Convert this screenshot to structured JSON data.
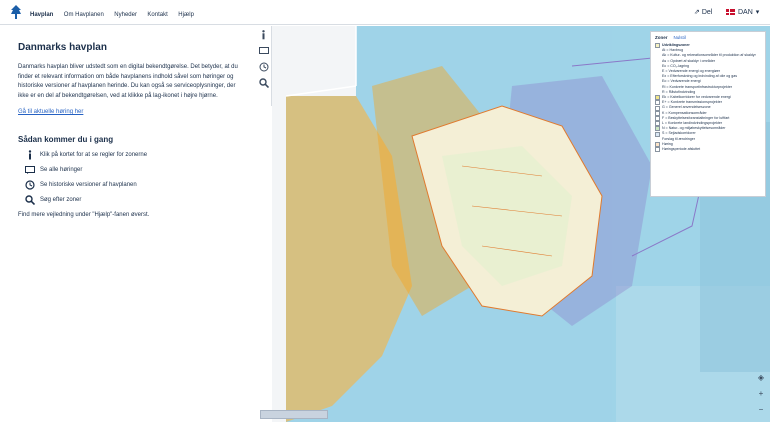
{
  "nav": {
    "items": [
      {
        "label": "Havplan",
        "active": true
      },
      {
        "label": "Om Havplanen",
        "active": false
      },
      {
        "label": "Nyheder",
        "active": false
      },
      {
        "label": "Kontakt",
        "active": false
      },
      {
        "label": "Hjælp",
        "active": false
      }
    ],
    "share_label": "Del",
    "language": "DAN"
  },
  "panel": {
    "title": "Danmarks havplan",
    "intro": "Danmarks havplan bliver udstedt som en digital bekendtgørelse. Det betyder, at du finder et relevant information om både havplanens indhold såvel som høringer og historiske versioner af havplanen herinde. Du kan også se serviceoplysninger, der ikke er en del af bekendtgørelsen, ved at klikke på lag-ikonet i højre hjørne.",
    "hearing_link": "Gå til aktuelle høring her",
    "howto_title": "Sådan kommer du i gang",
    "steps": [
      {
        "icon": "info-icon",
        "text": "Klik på kortet for at se regler for zonerne"
      },
      {
        "icon": "comment-icon",
        "text": "Se alle høringer"
      },
      {
        "icon": "history-icon",
        "text": "Se historiske versioner af havplanen"
      },
      {
        "icon": "search-icon",
        "text": "Søg efter zoner"
      }
    ],
    "footer": "Find mere vejledning under \"Hjælp\"-fanen øverst."
  },
  "legend": {
    "tabs": [
      "Zoner",
      "Nulstil"
    ],
    "groups": [
      {
        "label": "Udviklingszoner",
        "bold": true,
        "color": "#f7f3c4"
      },
      {
        "label": "At = Havbrug",
        "color": ""
      },
      {
        "label": "Ak = Kultur- og rekreationsområder til produktion af skaldyr",
        "color": ""
      },
      {
        "label": "As = Opdræt af skaldyr i områder",
        "color": ""
      },
      {
        "label": "Ec = CO₂-lagring",
        "color": ""
      },
      {
        "label": "E = Vedvarende energi og energiøer",
        "color": ""
      },
      {
        "label": "Ex = Efterforskning og indvinding af olie og gas",
        "color": ""
      },
      {
        "label": "Eo = Vedvarende energi",
        "color": ""
      },
      {
        "label": "Ri = Konkrete transportinfrastrukturprojekter",
        "color": ""
      },
      {
        "label": "R = Råstofindvinding",
        "color": ""
      },
      {
        "label": "Ek = Kabelkorridorer for vedvarende energi",
        "color": "#f2e68a"
      },
      {
        "label": "E+ = Konkrete transmissionsprojekter",
        "color": "#fff"
      },
      {
        "label": "G = Generel anvendelseszone",
        "color": "#fff"
      },
      {
        "label": "K = Kompensationsområder",
        "color": "#fff"
      },
      {
        "label": "F = Beskyttelsesforanstaltninger for luftfart",
        "color": "#fff"
      },
      {
        "label": "L = Konkrete landindvindingsprojekter",
        "color": "#fff"
      },
      {
        "label": "N = Natur- og miljøbeskyttelsesområder",
        "color": "#cfe8c4"
      },
      {
        "label": "S = Sejladskorridorer",
        "color": "#dbe8f5"
      },
      {
        "label": "Forslag til ændringer",
        "color": ""
      },
      {
        "label": "Høring",
        "color": "#fde4c8"
      },
      {
        "label": "Høringsperiode afsluttet",
        "color": "#fff"
      }
    ]
  },
  "map_controls": [
    "layers-icon",
    "zoom-in-icon",
    "zoom-out-icon"
  ],
  "colors": {
    "accent": "#2561c3",
    "text": "#1b2f4a",
    "sea": "#9fd3e8",
    "zone_orange": "#f5a623",
    "zone_purple": "#8a78c8",
    "land": "#f4efd6"
  }
}
